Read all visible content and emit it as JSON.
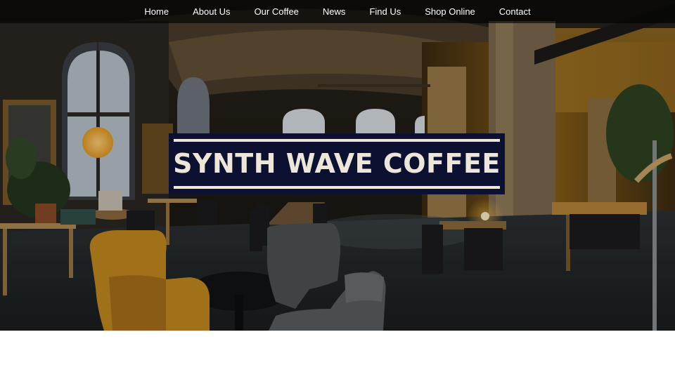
{
  "nav": {
    "items": [
      {
        "label": "Home"
      },
      {
        "label": "About Us"
      },
      {
        "label": "Our Coffee"
      },
      {
        "label": "News"
      },
      {
        "label": "Find Us"
      },
      {
        "label": "Shop Online"
      },
      {
        "label": "Contact"
      }
    ]
  },
  "hero": {
    "title": "SYNTH WAVE COFFEE",
    "banner_color": "#0c1131",
    "banner_text_color": "#ece7d9"
  }
}
